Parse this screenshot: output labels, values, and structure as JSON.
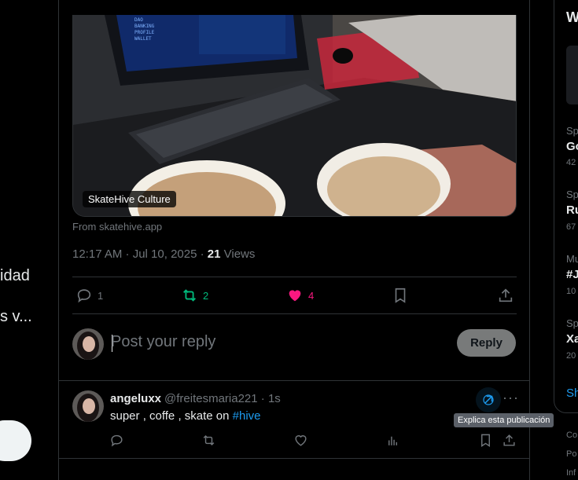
{
  "left_nav": {
    "item1_fragment": "idad",
    "item2_fragment": "s v..."
  },
  "post": {
    "card_label": "SkateHive Culture",
    "source": "From skatehive.app",
    "timestamp": "12:17 AM · Jul 10, 2025 · ",
    "views_count": "21",
    "views_label": " Views",
    "replies": "1",
    "reposts": "2",
    "likes": "4"
  },
  "reply_box": {
    "placeholder": "Post your reply",
    "button": "Reply"
  },
  "reply_tweet": {
    "name": "angeluxx",
    "handle": "@freitesmaria221 · 1s",
    "text_before": "super , coffe , skate on ",
    "hashtag": "#hive",
    "tooltip": "Explica esta publicación"
  },
  "right_column": {
    "header_fragment": "W",
    "items": [
      {
        "category": "Sp",
        "title": "Go",
        "count": "42"
      },
      {
        "category": "Sp",
        "title": "Ru",
        "count": "67"
      },
      {
        "category": "Mu",
        "title": "#J",
        "count": "10"
      },
      {
        "category": "Sp",
        "title": "Xa",
        "count": "20"
      }
    ],
    "show_more": "Sh",
    "footer": [
      "Co",
      "Po",
      "Inf"
    ]
  },
  "colors": {
    "repost": "#00ba7c",
    "like": "#f91880",
    "link": "#1d9bf0"
  }
}
